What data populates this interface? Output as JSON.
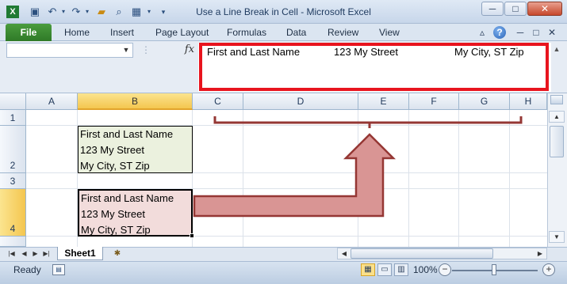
{
  "window": {
    "title": "Use a Line Break in Cell  -  Microsoft Excel",
    "qat_icons": [
      "excel-logo-icon",
      "save-icon",
      "undo-icon",
      "redo-icon",
      "open-folder-icon",
      "print-preview-icon",
      "table-icon",
      "customize-qat-icon"
    ],
    "controls": {
      "minimize": "─",
      "restore": "□",
      "close": "✕"
    }
  },
  "ribbon": {
    "file_tab": "File",
    "tabs": [
      "Home",
      "Insert",
      "Page Layout",
      "Formulas",
      "Data",
      "Review",
      "View"
    ],
    "right_icons": {
      "minimize_ribbon": "▵",
      "help": "?",
      "doc_minimize": "─",
      "doc_restore": "□",
      "doc_close": "✕"
    }
  },
  "formula_bar": {
    "name_box_value": "",
    "fx_label": "fx",
    "content_parts": [
      "First and Last Name",
      "123 My Street",
      "My City, ST Zip"
    ],
    "highlight_color": "#e8141e"
  },
  "grid": {
    "columns": [
      "A",
      "B",
      "C",
      "D",
      "E",
      "F",
      "G",
      "H"
    ],
    "selected_column": "B",
    "rows": [
      "1",
      "2",
      "3",
      "4"
    ],
    "selected_row": "4",
    "cells": {
      "B2": [
        "First and Last Name",
        "123 My Street",
        "My City, ST Zip"
      ],
      "B4": [
        "First and Last Name",
        "123 My Street",
        "My City, ST Zip"
      ]
    },
    "cell_colors": {
      "B2": "#ebf1de",
      "B4": "#f2dcdb"
    },
    "annotation": {
      "shape": "bracket-arrow",
      "fill": "#d99594",
      "stroke": "#953734"
    }
  },
  "sheet_tabs": {
    "nav": [
      "|◀",
      "◀",
      "▶",
      "▶|"
    ],
    "active": "Sheet1"
  },
  "status_bar": {
    "status": "Ready",
    "zoom": "100%",
    "zoom_minus": "−",
    "zoom_plus": "+"
  }
}
